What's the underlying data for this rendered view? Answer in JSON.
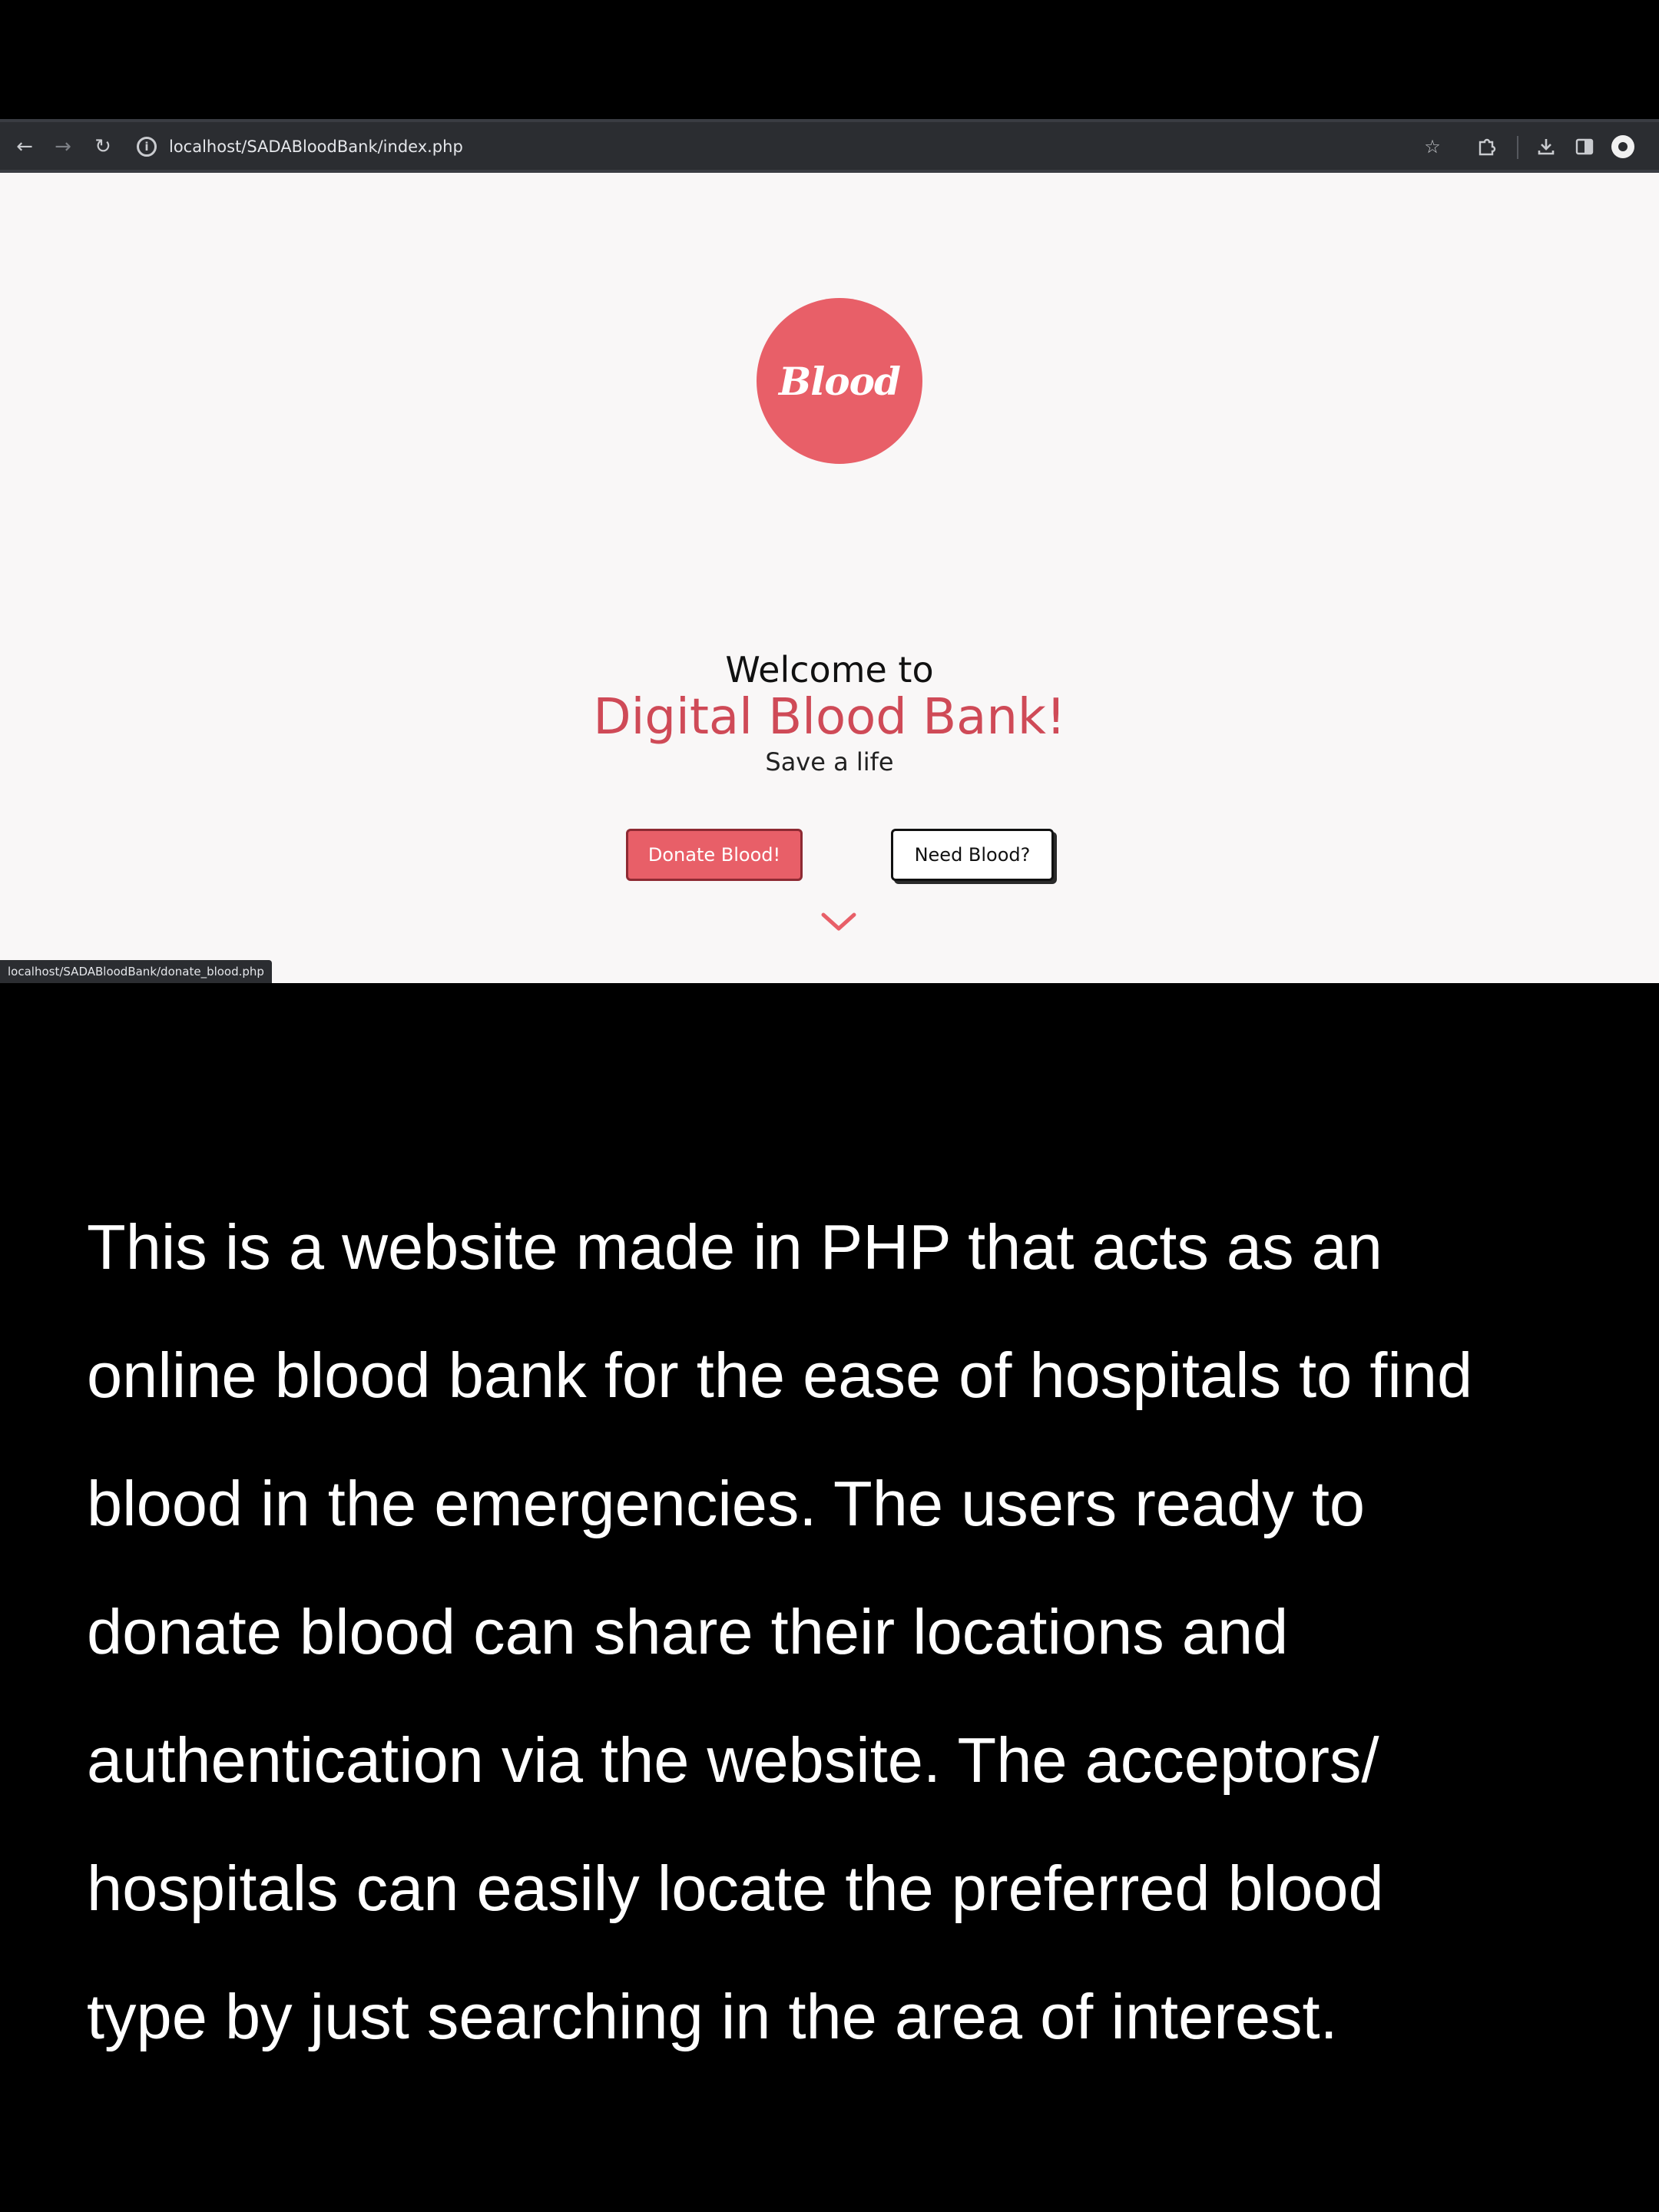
{
  "browser": {
    "url": "localhost/SADABloodBank/index.php",
    "status_url": "localhost/SADABloodBank/donate_blood.php",
    "icons": {
      "back": "arrow-left",
      "forward": "arrow-right",
      "reload": "reload",
      "site_info": "info-circle",
      "bookmark": "star",
      "extensions": "puzzle",
      "downloads": "download",
      "side_panel": "side-panel",
      "profile": "profile"
    }
  },
  "site": {
    "logo_text": "Blood",
    "welcome": "Welcome to",
    "title": "Digital Blood Bank!",
    "tagline": "Save a life",
    "donate_button": "Donate Blood!",
    "need_button": "Need Blood?",
    "colors": {
      "accent": "#e85f68",
      "title": "#cf4a57",
      "background": "#f9f7f7"
    }
  },
  "caption": {
    "lines": [
      "This is a website made in PHP that acts as an",
      "online blood bank for the ease of hospitals to find",
      "blood in the emergencies. The users ready to",
      "donate blood can share their locations and",
      "authentication via the website. The acceptors/",
      "hospitals can easily locate the preferred blood",
      "type by just searching in the area of interest."
    ]
  }
}
